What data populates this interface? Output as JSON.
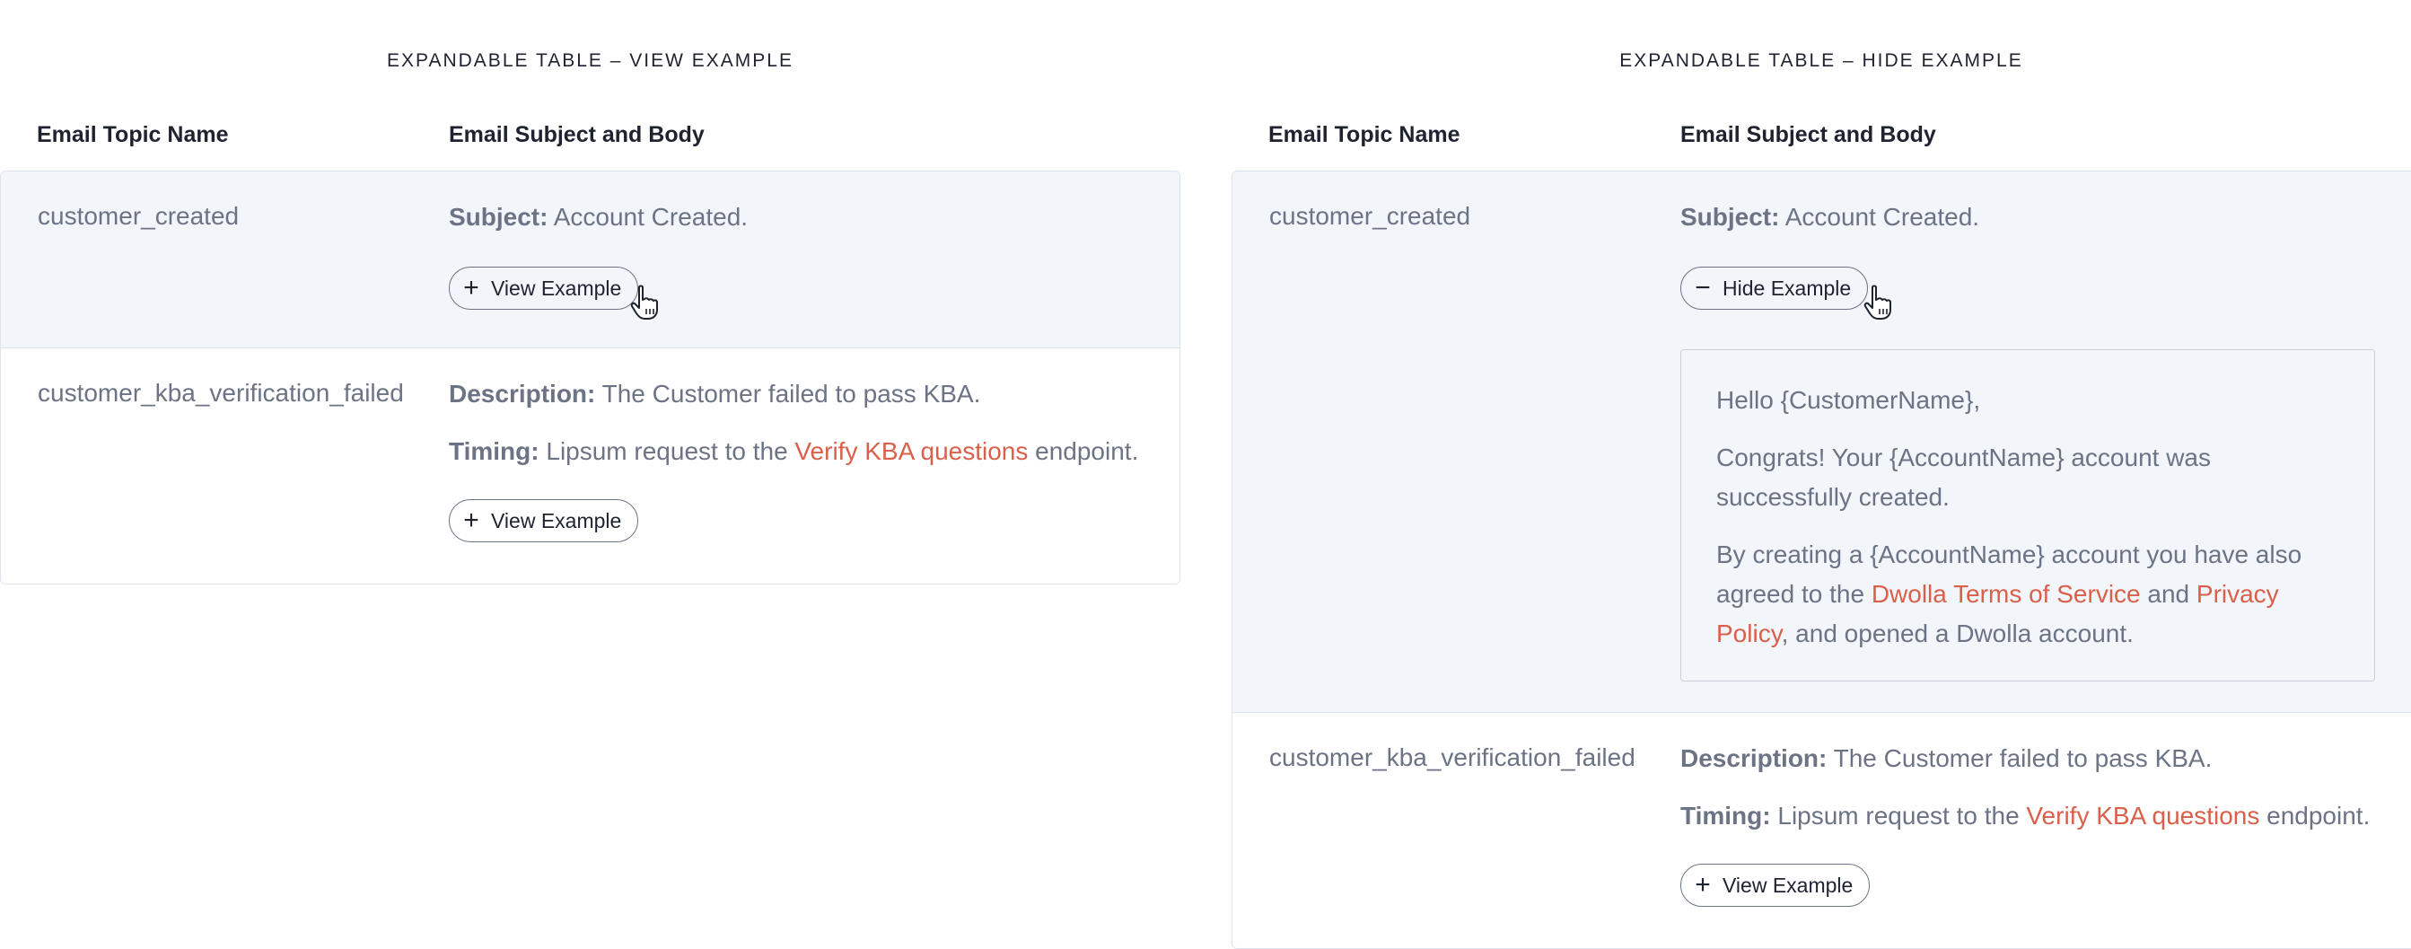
{
  "left": {
    "title": "EXPANDABLE TABLE – VIEW EXAMPLE",
    "col1": "Email Topic Name",
    "col2": "Email Subject and Body",
    "rows": [
      {
        "topic": "customer_created",
        "subject_label": "Subject:",
        "subject_text": " Account Created.",
        "button": "View Example"
      },
      {
        "topic": "customer_kba_verification_failed",
        "desc_label": "Description:",
        "desc_text": " The Customer failed to pass KBA.",
        "timing_label": "Timing:",
        "timing_pre": " Lipsum request to the ",
        "timing_link": "Verify KBA questions",
        "timing_post": " endpoint.",
        "button": "View Example"
      }
    ]
  },
  "right": {
    "title": "EXPANDABLE TABLE – HIDE EXAMPLE",
    "col1": "Email Topic Name",
    "col2": "Email Subject and Body",
    "rows": [
      {
        "topic": "customer_created",
        "subject_label": "Subject:",
        "subject_text": " Account Created.",
        "button": "Hide Example",
        "example": {
          "greeting": "Hello {CustomerName},",
          "para1_a": "Congrats! Your {AccountName} account was",
          "para1_b": "successfully created.",
          "para2_a": "By creating a {AccountName} account you have also",
          "para2_b_pre": "agreed to the ",
          "para2_b_link1": "Dwolla Terms of Service",
          "para2_b_mid": " and ",
          "para2_b_link2a": "Privacy",
          "para2_c_link2b": "Policy",
          "para2_c_post": ", and opened a Dwolla account."
        }
      },
      {
        "topic": "customer_kba_verification_failed",
        "desc_label": "Description:",
        "desc_text": " The Customer failed to pass KBA.",
        "timing_label": "Timing:",
        "timing_pre": " Lipsum request to the ",
        "timing_link": "Verify KBA questions",
        "timing_post": " endpoint.",
        "button": "View Example"
      }
    ]
  },
  "icons": {
    "plus": "plus-icon",
    "minus": "minus-icon",
    "cursor": "hand-pointer-icon"
  },
  "colors": {
    "text": "#6b7385",
    "heading": "#1f2330",
    "link": "#d9604a",
    "row_shade": "#f2f5fa",
    "border": "#dfe4ec"
  }
}
